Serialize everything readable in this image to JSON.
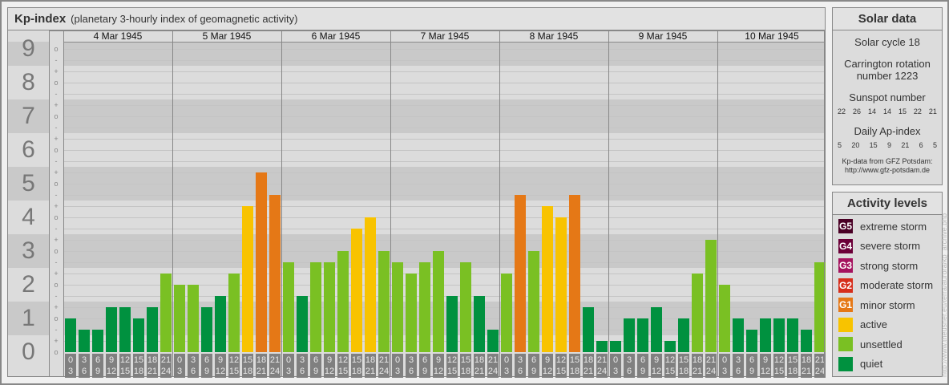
{
  "header": {
    "title": "Kp-index",
    "subtitle": "(planetary 3-hourly index of geomagnetic activity)"
  },
  "chart_data": {
    "type": "bar",
    "title": "Kp-index",
    "ylabel": "Kp",
    "ylim": [
      0,
      9.33
    ],
    "y_ticks": [
      "0",
      "1",
      "2",
      "3",
      "4",
      "5",
      "6",
      "7",
      "8",
      "9"
    ],
    "sub_ticks": [
      "-",
      "o",
      "+"
    ],
    "days": [
      "4 Mar 1945",
      "5 Mar 1945",
      "6 Mar 1945",
      "7 Mar 1945",
      "8 Mar 1945",
      "9 Mar 1945",
      "10 Mar 1945"
    ],
    "intervals": [
      [
        "0",
        "3"
      ],
      [
        "3",
        "6"
      ],
      [
        "6",
        "9"
      ],
      [
        "9",
        "12"
      ],
      [
        "12",
        "15"
      ],
      [
        "15",
        "18"
      ],
      [
        "18",
        "21"
      ],
      [
        "21",
        "24"
      ]
    ],
    "values": [
      [
        1.0,
        0.67,
        0.67,
        1.33,
        1.33,
        1.0,
        1.33,
        2.33
      ],
      [
        2.0,
        2.0,
        1.33,
        1.67,
        2.33,
        4.33,
        5.33,
        4.67
      ],
      [
        2.67,
        1.67,
        2.67,
        2.67,
        3.0,
        3.67,
        4.0,
        3.0
      ],
      [
        2.67,
        2.33,
        2.67,
        3.0,
        1.67,
        2.67,
        1.67,
        0.67
      ],
      [
        2.33,
        4.67,
        3.0,
        4.33,
        4.0,
        4.67,
        1.33,
        0.33
      ],
      [
        0.33,
        1.0,
        1.0,
        1.33,
        0.33,
        1.0,
        2.33,
        3.33
      ],
      [
        2.0,
        1.0,
        0.67,
        1.0,
        1.0,
        1.0,
        0.67,
        2.67
      ]
    ],
    "colors": {
      "quiet": "#00913f",
      "unsettled": "#7ac023",
      "active": "#f8c300",
      "minor": "#e57816",
      "moderate": "#d62e1c",
      "strong": "#a5135f",
      "severe": "#6b0038",
      "extreme": "#4a0025"
    }
  },
  "solar": {
    "title": "Solar data",
    "cycle": "Solar cycle 18",
    "carrington1": "Carrington rotation",
    "carrington2": "number 1223",
    "sunspot_label": "Sunspot number",
    "sunspots": [
      "22",
      "26",
      "14",
      "14",
      "15",
      "22",
      "21"
    ],
    "ap_label": "Daily Ap-index",
    "ap": [
      "5",
      "20",
      "15",
      "9",
      "21",
      "6",
      "5"
    ],
    "source1": "Kp-data from GFZ Potsdam:",
    "source2": "http://www.gfz-potsdam.de"
  },
  "activity": {
    "title": "Activity levels",
    "items": [
      {
        "code": "G5",
        "label": "extreme storm",
        "color": "#4a0025"
      },
      {
        "code": "G4",
        "label": "severe storm",
        "color": "#6b0038"
      },
      {
        "code": "G3",
        "label": "strong storm",
        "color": "#a5135f"
      },
      {
        "code": "G2",
        "label": "moderate storm",
        "color": "#d62e1c"
      },
      {
        "code": "G1",
        "label": "minor storm",
        "color": "#e57816"
      },
      {
        "code": "",
        "label": "active",
        "color": "#f8c300"
      },
      {
        "code": "",
        "label": "unsettled",
        "color": "#7ac023"
      },
      {
        "code": "",
        "label": "quiet",
        "color": "#00913f"
      }
    ]
  },
  "watermark": "http://www.theusner.eu/terra/aurora/kp_archive.php"
}
